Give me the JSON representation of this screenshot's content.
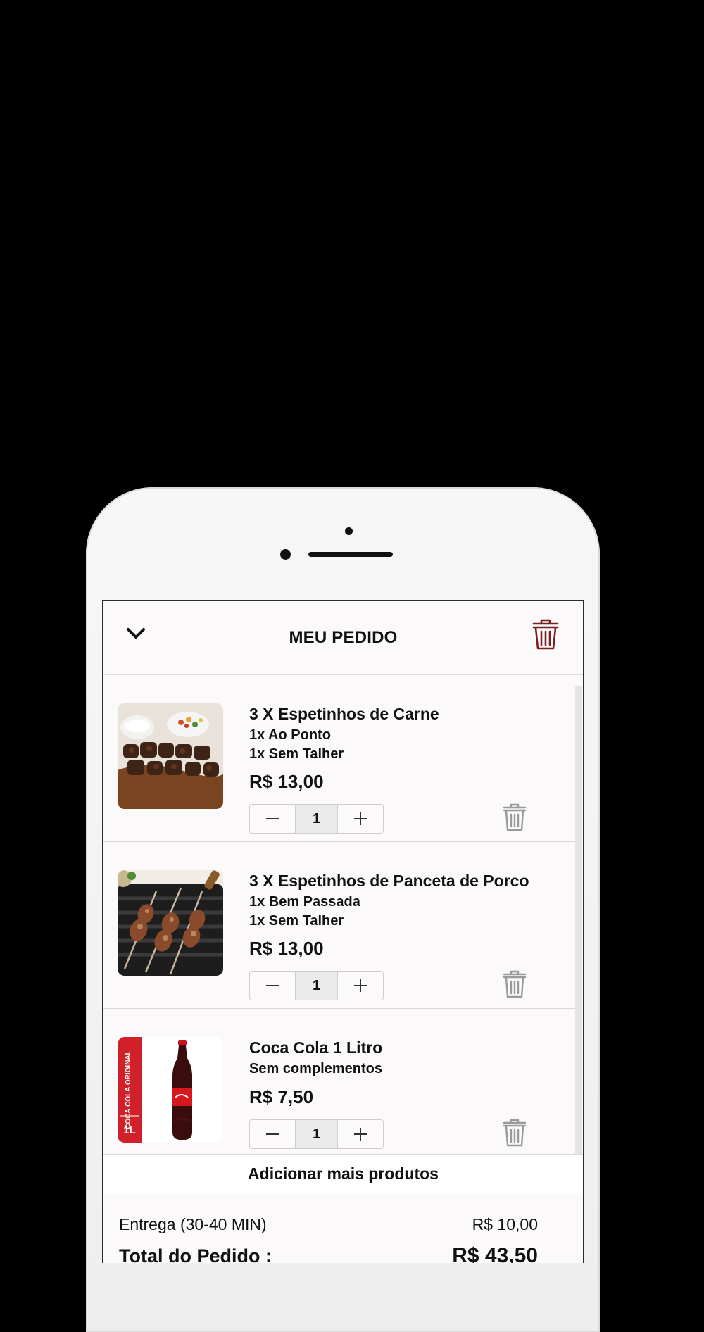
{
  "header": {
    "title": "MEU PEDIDO",
    "back_icon": "chevron-down-icon",
    "clear_icon": "trash-icon",
    "accent_color": "#7a1f22"
  },
  "items": [
    {
      "name": "3 X Espetinhos de Carne",
      "options": [
        "1x Ao Ponto",
        "1x Sem Talher"
      ],
      "price": "R$ 13,00",
      "quantity": "1",
      "image": "grilled-beef-skewers"
    },
    {
      "name": "3 X Espetinhos de Panceta de Porco",
      "options": [
        "1x Bem Passada",
        "1x Sem Talher"
      ],
      "price": "R$ 13,00",
      "quantity": "1",
      "image": "pork-belly-skewers-on-grill"
    },
    {
      "name": "Coca Cola 1 Litro",
      "options": [
        "Sem complementos"
      ],
      "price": "R$ 7,50",
      "quantity": "1",
      "image": "coca-cola-bottle",
      "image_side_text": "COCA COLA ORIGINAL",
      "image_size_text": "1L"
    }
  ],
  "add_more_label": "Adicionar mais produtos",
  "summary": {
    "delivery_label": "Entrega (30-40 MIN)",
    "delivery_value": "R$ 10,00",
    "total_label": "Total do Pedido :",
    "total_value": "R$ 43,50"
  }
}
